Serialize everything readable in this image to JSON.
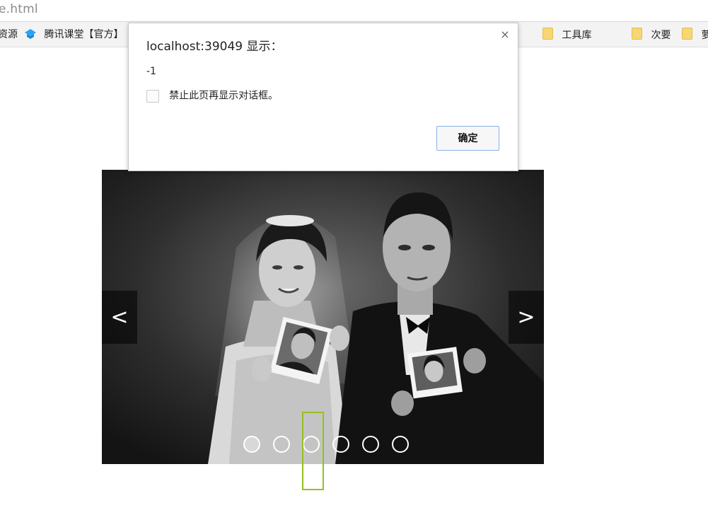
{
  "browser": {
    "url_fragment": "e.html"
  },
  "bookmarks": [
    {
      "label": "资源",
      "icon": "none"
    },
    {
      "label": "腾讯课堂【官方】",
      "icon": "tencent-classroom-icon"
    },
    {
      "label": "工具库",
      "icon": "folder-icon"
    },
    {
      "label": "次要",
      "icon": "folder-icon"
    },
    {
      "label": "萝",
      "icon": "folder-icon"
    }
  ],
  "dialog": {
    "title": "localhost:39049 显示：",
    "message": "-1",
    "checkbox_label": "禁止此页再显示对话框。",
    "checkbox_checked": false,
    "ok_label": "确定",
    "close_glyph": "×"
  },
  "carousel": {
    "prev_label": "<",
    "next_label": ">",
    "slide_count": 6,
    "active_index": 0
  },
  "colors": {
    "highlight": "#95c11f",
    "ok_border": "#8ab0e6"
  }
}
